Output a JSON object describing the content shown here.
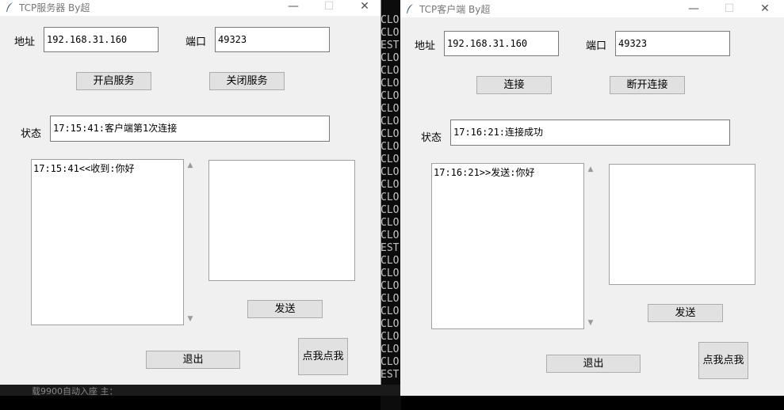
{
  "server": {
    "title": "TCP服务器  By超",
    "address_label": "地址",
    "address_value": "192.168.31.160",
    "port_label": "端口",
    "port_value": "49323",
    "start_button": "开启服务",
    "stop_button": "关闭服务",
    "status_label": "状态",
    "status_value": "17:15:41:客户端第1次连接",
    "log_text": "17:15:41<<收到:你好",
    "input_text": "",
    "send_button": "发送",
    "exit_button": "退出",
    "click_button": "点我点我"
  },
  "client": {
    "title": "TCP客户端  By超",
    "address_label": "地址",
    "address_value": "192.168.31.160",
    "port_label": "端口",
    "port_value": "49323",
    "connect_button": "连接",
    "disconnect_button": "断开连接",
    "status_label": "状态",
    "status_value": "17:16:21:连接成功",
    "log_text": "17:16:21>>发送:你好",
    "input_text": "",
    "send_button": "发送",
    "exit_button": "退出",
    "click_button": "点我点我"
  },
  "console": {
    "lines": [
      "CLO",
      "CLO",
      "EST",
      "CLO",
      "CLO",
      "CLO",
      "CLO",
      "CLO",
      "CLO",
      "CLO",
      "CLO",
      "CLO",
      "CLO",
      "CLO",
      "CLO",
      "CLO",
      "CLO",
      "CLO",
      "EST",
      "CLO",
      "CLO",
      "CLO",
      "CLO",
      "CLO",
      "CLO",
      "CLO",
      "CLO",
      "CLO",
      "EST"
    ]
  },
  "taskbar_text": "载9900自动入座 主：",
  "window_buttons": {
    "minimize": "—",
    "maximize": "☐",
    "close": "✕"
  }
}
